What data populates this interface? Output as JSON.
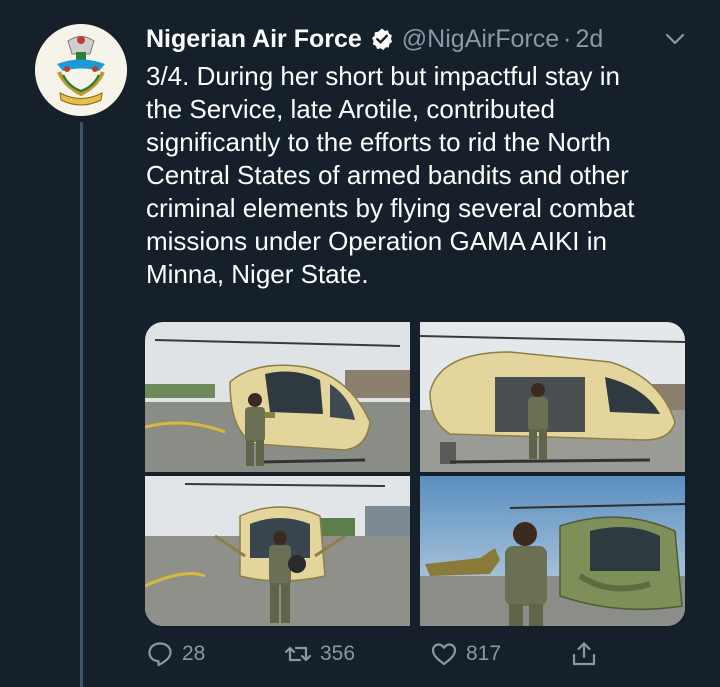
{
  "tweet": {
    "author_name": "Nigerian Air Force",
    "handle": "@NigAirForce",
    "separator": "·",
    "time": "2d",
    "text_lines": [
      "3/4. During her short but impactful stay in",
      "the Service, late Arotile, contributed",
      "significantly to the efforts to rid the North",
      "Central States of armed bandits and other",
      "criminal elements by flying several combat",
      "missions under Operation GAMA AIKI in",
      "Minna, Niger State."
    ]
  },
  "actions": {
    "replies": "28",
    "retweets": "356",
    "likes": "817"
  },
  "icons": {
    "verified": "verified-badge-icon",
    "more": "chevron-down-icon",
    "reply": "reply-icon",
    "retweet": "retweet-icon",
    "like": "heart-icon",
    "share": "share-icon"
  },
  "colors": {
    "background": "#15202b",
    "secondary_text": "#8899a6",
    "aircraft_yellow": "#e9d79b",
    "aircraft_green": "#7f8f5a"
  }
}
